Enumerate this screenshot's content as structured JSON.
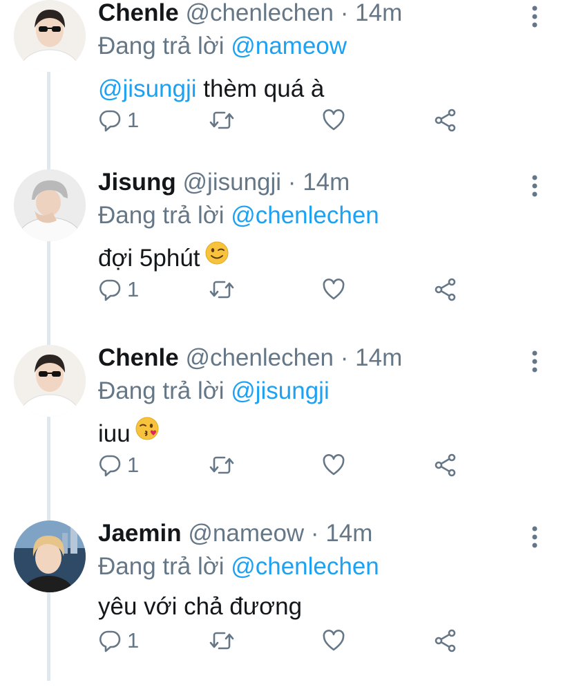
{
  "tweets": [
    {
      "name": "Chenle",
      "handle": "@chenlechen",
      "separator": "·",
      "time": "14m",
      "replying_prefix": "Đang trả lời",
      "replying_to": "@nameow",
      "body_mention": "@jisungji",
      "body_text": " thèm quá à",
      "emoji": "",
      "reply_count": "1",
      "avatar_bg": "#f2efea"
    },
    {
      "name": "Jisung",
      "handle": "@jisungji",
      "separator": "·",
      "time": "14m",
      "replying_prefix": "Đang trả lời",
      "replying_to": "@chenlechen",
      "body_mention": "",
      "body_text": "đợi 5phút",
      "emoji": "winking-face",
      "reply_count": "1",
      "avatar_bg": "#e9e9e9"
    },
    {
      "name": "Chenle",
      "handle": "@chenlechen",
      "separator": "·",
      "time": "14m",
      "replying_prefix": "Đang trả lời",
      "replying_to": "@jisungji",
      "body_mention": "",
      "body_text": "iuu",
      "emoji": "kissing-face",
      "reply_count": "1",
      "avatar_bg": "#f2efea"
    },
    {
      "name": "Jaemin",
      "handle": "@nameow",
      "separator": "·",
      "time": "14m",
      "replying_prefix": "Đang trả lời",
      "replying_to": "@chenlechen",
      "body_mention": "",
      "body_text": "yêu với chả đương",
      "emoji": "",
      "reply_count": "1",
      "avatar_bg": "#4a6a8c"
    }
  ],
  "colors": {
    "link": "#1da1f2",
    "meta": "#657786",
    "icon": "#657786",
    "text": "#14171a",
    "thread_line": "#e1e8ed"
  },
  "icons": [
    "reply-icon",
    "retweet-icon",
    "like-icon",
    "share-icon",
    "more-icon"
  ]
}
